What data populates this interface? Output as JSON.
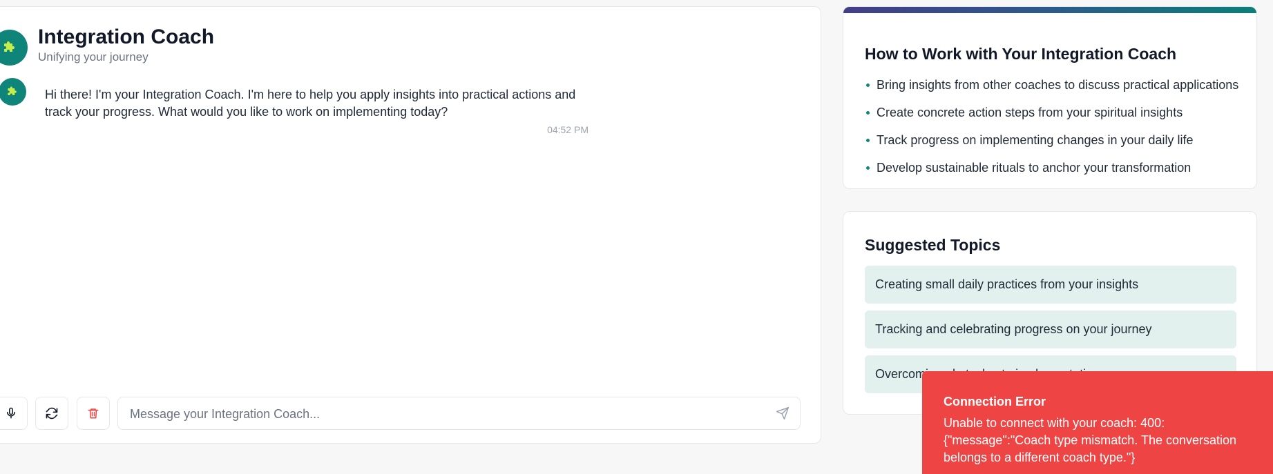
{
  "coach": {
    "name": "Integration Coach",
    "tagline": "Unifying your journey",
    "avatar_icon": "puzzle-piece-icon",
    "avatar_color": "#0f857a",
    "icon_color": "#c6ee4a"
  },
  "chat": {
    "messages": [
      {
        "text": "Hi there! I'm your Integration Coach. I'm here to help you apply insights into practical actions and track your progress. What would you like to work on implementing today?",
        "time": "04:52 PM"
      }
    ],
    "input_placeholder": "Message your Integration Coach...",
    "controls": {
      "mic_icon": "microphone-icon",
      "refresh_icon": "refresh-icon",
      "delete_icon": "trash-icon",
      "send_icon": "send-icon"
    }
  },
  "howto": {
    "title": "How to Work with Your Integration Coach",
    "items": [
      "Bring insights from other coaches to discuss practical applications",
      "Create concrete action steps from your spiritual insights",
      "Track progress on implementing changes in your daily life",
      "Develop sustainable rituals to anchor your transformation"
    ]
  },
  "topics": {
    "title": "Suggested Topics",
    "items": [
      "Creating small daily practices from your insights",
      "Tracking and celebrating progress on your journey",
      "Overcoming obstacles to implementation"
    ]
  },
  "error_toast": {
    "title": "Connection Error",
    "message": "Unable to connect with your coach: 400: {\"message\":\"Coach type mismatch. The conversation belongs to a different coach type.\"}",
    "color": "#ef4444"
  },
  "colors": {
    "accent": "#0f857a",
    "topic_bg": "#e2f0ee",
    "delete_red": "#ef4444"
  }
}
